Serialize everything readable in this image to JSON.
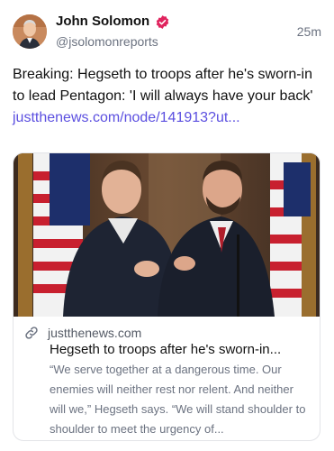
{
  "author": {
    "name": "John Solomon",
    "handle": "@jsolomonreports",
    "avatar_icon": "profile-photo",
    "verified_badge_icon": "verified-badge-icon",
    "badge_color": "#e0245e"
  },
  "timestamp": "25m",
  "post": {
    "text": "Breaking: Hegseth to troops after he's sworn-in to lead Pentagon: 'I will always have your back' ",
    "link_text": "justthenews.com/node/141913?ut..."
  },
  "link_card": {
    "image_alt": "Two men in suits embracing in front of American flags",
    "domain": "justthenews.com",
    "title": "Hegseth to troops after he's sworn-in...",
    "description": "“We serve together at a dangerous time. Our enemies will neither rest nor relent. And neither will we,” Hegseth says. “We will stand shoulder to shoulder to meet the urgency of..."
  },
  "colors": {
    "link": "#5b4fe0",
    "muted_text": "#6b7280",
    "card_border": "#e3e4e8"
  }
}
